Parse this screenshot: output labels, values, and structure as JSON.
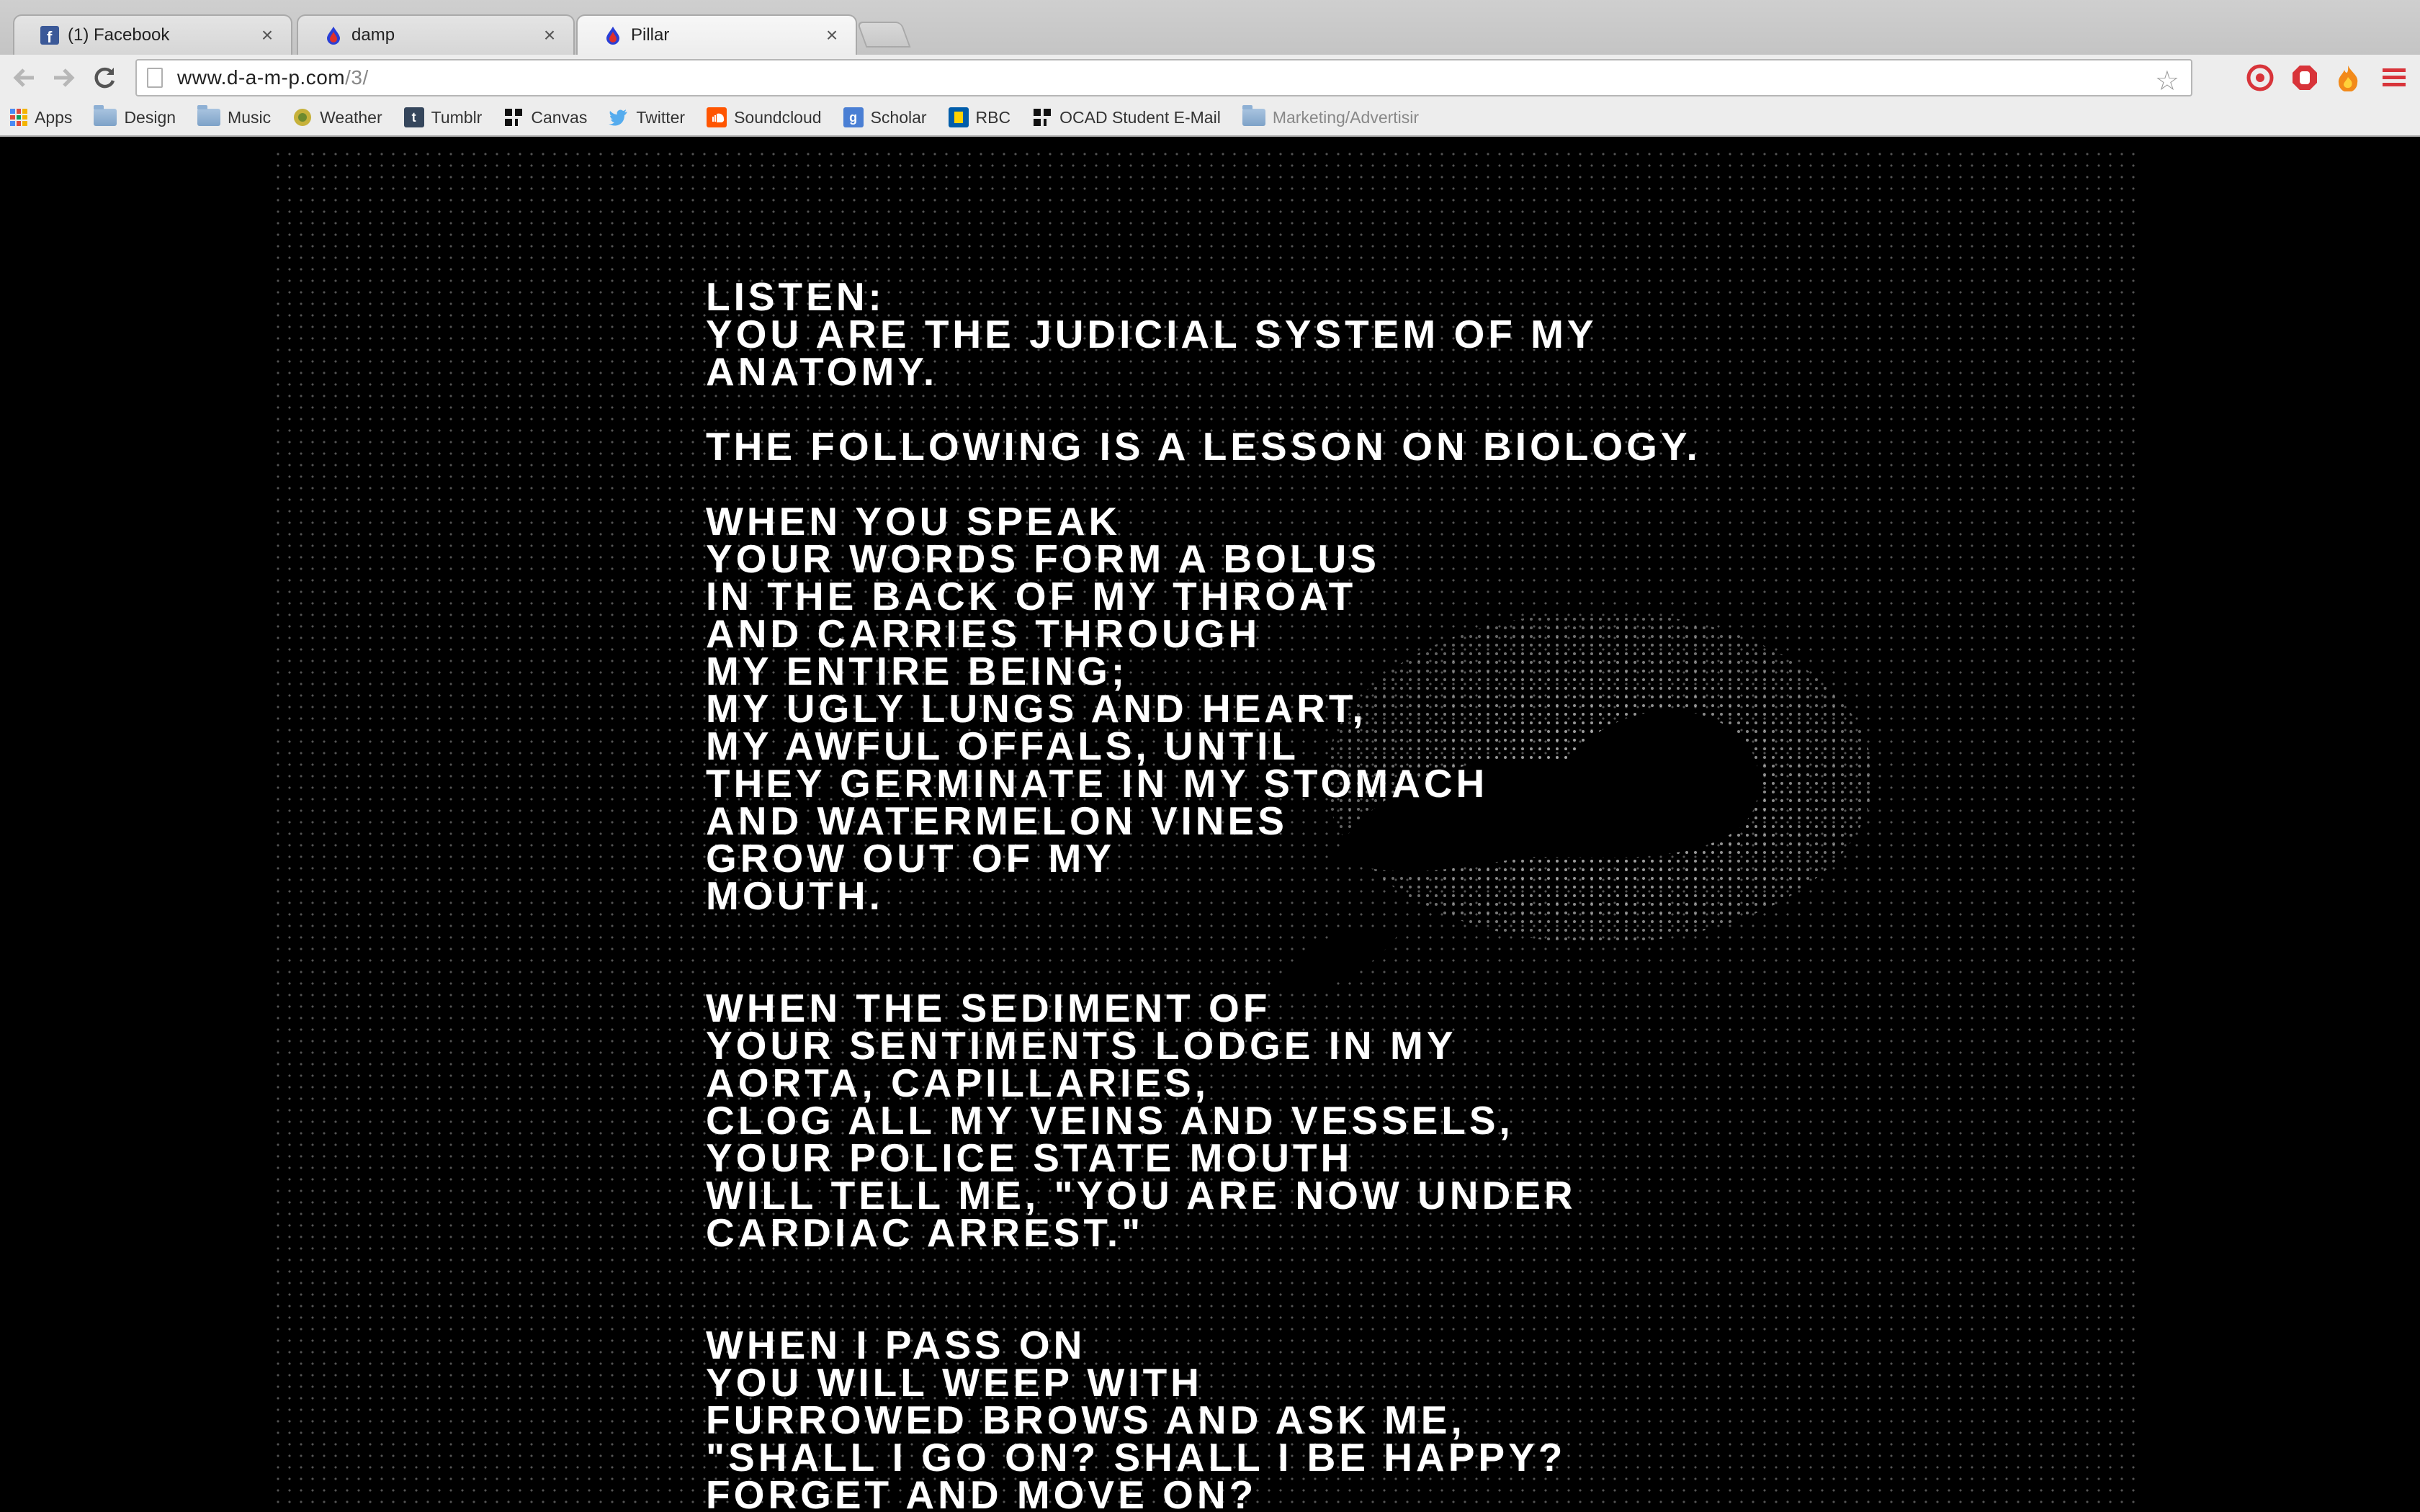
{
  "browser": {
    "tabs": [
      {
        "label": "(1) Facebook",
        "icon": "facebook-icon",
        "active": false
      },
      {
        "label": "damp",
        "icon": "damp-droplet-icon",
        "active": false
      },
      {
        "label": "Pillar",
        "icon": "damp-droplet-icon",
        "active": true
      }
    ],
    "tab_close_glyph": "×",
    "url_host": "www.d-a-m-p.com",
    "url_path": "/3/",
    "bookmarks": [
      {
        "label": "Apps",
        "icon": "apps-grid-icon"
      },
      {
        "label": "Design",
        "icon": "folder-icon"
      },
      {
        "label": "Music",
        "icon": "folder-icon"
      },
      {
        "label": "Weather",
        "icon": "weather-icon"
      },
      {
        "label": "Tumblr",
        "icon": "tumblr-icon"
      },
      {
        "label": "Canvas",
        "icon": "canvas-icon"
      },
      {
        "label": "Twitter",
        "icon": "twitter-icon"
      },
      {
        "label": "Soundcloud",
        "icon": "soundcloud-icon"
      },
      {
        "label": "Scholar",
        "icon": "scholar-icon"
      },
      {
        "label": "RBC",
        "icon": "rbc-icon"
      },
      {
        "label": "OCAD Student E-Mail",
        "icon": "ocad-icon"
      },
      {
        "label": "Marketing/Advertisir",
        "icon": "folder-icon"
      }
    ],
    "colors": {
      "facebook": "#3b5998",
      "twitter": "#55acee",
      "soundcloud": "#ff5500",
      "rbc": "#005daa",
      "tumblr": "#35465c"
    }
  },
  "poem": {
    "stanzas": [
      [
        "LISTEN:",
        "YOU ARE THE JUDICIAL SYSTEM OF MY",
        "ANATOMY."
      ],
      [
        "THE FOLLOWING IS A LESSON ON BIOLOGY."
      ],
      [
        "WHEN YOU SPEAK",
        "YOUR WORDS FORM A BOLUS",
        "IN THE BACK OF MY THROAT",
        "AND CARRIES THROUGH",
        "MY ENTIRE BEING;",
        "MY UGLY LUNGS AND HEART,",
        "MY AWFUL OFFALS, UNTIL",
        "THEY GERMINATE IN MY STOMACH",
        "AND WATERMELON VINES",
        "GROW OUT OF MY",
        "MOUTH."
      ],
      [
        "WHEN THE SEDIMENT OF",
        "YOUR SENTIMENTS LODGE IN MY",
        "AORTA, CAPILLARIES,",
        "CLOG ALL MY VEINS AND VESSELS,",
        "YOUR POLICE STATE MOUTH",
        "WILL TELL ME, \"YOU ARE NOW UNDER",
        "CARDIAC ARREST.\""
      ],
      [
        "WHEN I PASS ON",
        "YOU WILL WEEP WITH",
        "FURROWED BROWS AND ASK ME,",
        "\"SHALL I GO ON? SHALL I BE HAPPY?",
        "FORGET AND MOVE ON?"
      ]
    ]
  }
}
